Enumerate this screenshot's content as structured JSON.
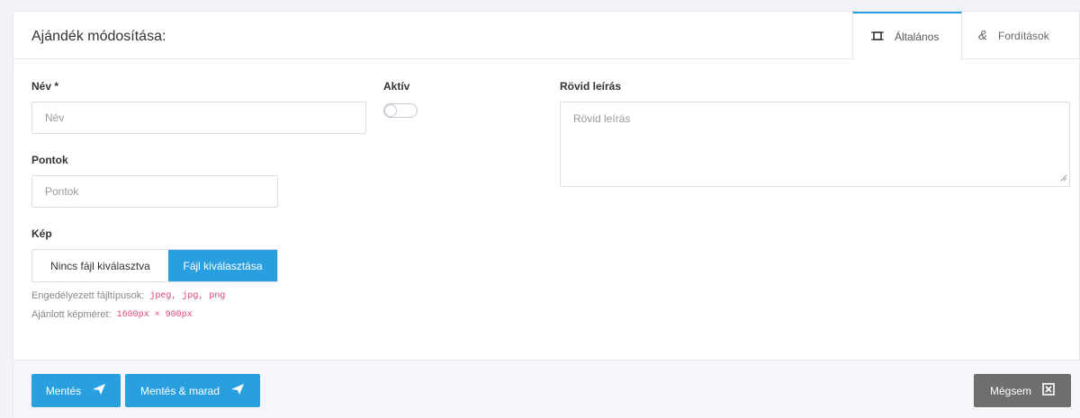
{
  "header": {
    "title": "Ajándék módosítása:",
    "tabs": [
      {
        "label": "Általános",
        "icon": "frame-icon"
      },
      {
        "label": "Fordítások",
        "icon": "ampersand-icon"
      }
    ]
  },
  "form": {
    "name_label": "Név *",
    "name_placeholder": "Név",
    "active_label": "Aktív",
    "active_value": false,
    "short_desc_label": "Rövid leírás",
    "short_desc_placeholder": "Rövid leírás",
    "points_label": "Pontok",
    "points_placeholder": "Pontok",
    "image_label": "Kép",
    "file_status": "Nincs fájl kiválasztva",
    "file_button": "Fájl kiválasztása",
    "allowed_types_label": "Engedélyezett fájltípusok:",
    "allowed_types_value": "jpeg, jpg, png",
    "recommended_size_label": "Ajánlott képméret:",
    "recommended_size_value": "1600px × 900px"
  },
  "footer": {
    "save_label": "Mentés",
    "save_stay_label": "Mentés & marad",
    "cancel_label": "Mégsem"
  },
  "colors": {
    "accent": "#2a9fe0",
    "cancel": "#6e6e6e",
    "code": "#e0447b"
  }
}
